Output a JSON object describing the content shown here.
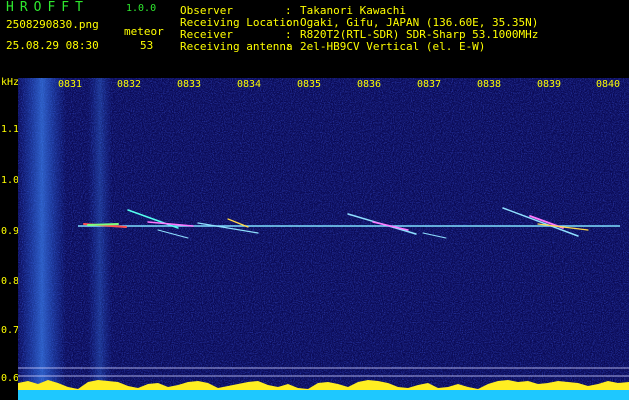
{
  "header": {
    "app_name": "HROFFT",
    "version": "1.0.0",
    "filename": "2508290830.png",
    "datetime": "25.08.29 08:30",
    "meteor_label": "meteor",
    "meteor_count": "53",
    "fields": [
      {
        "label": "Observer",
        "value": "Takanori Kawachi"
      },
      {
        "label": "Receiving Location",
        "value": "Ogaki, Gifu, JAPAN (136.60E, 35.35N)"
      },
      {
        "label": "Receiver",
        "value": "R820T2(RTL-SDR) SDR-Sharp 53.1000MHz"
      },
      {
        "label": "Receiving antenna",
        "value": "2el-HB9CV Vertical (el. E-W)"
      }
    ],
    "separator": ":"
  },
  "axes": {
    "y_unit": "kHz",
    "y_ticks": [
      "1.1",
      "1.0",
      "0.9",
      "0.8",
      "0.7",
      "0.6"
    ],
    "x_ticks": [
      "0831",
      "0832",
      "0833",
      "0834",
      "0835",
      "0836",
      "0837",
      "0838",
      "0839",
      "0840"
    ]
  },
  "colors": {
    "text": "#ffff00",
    "title": "#2ee82e",
    "background": "#0a0a55",
    "signal": "#7fdfff"
  }
}
